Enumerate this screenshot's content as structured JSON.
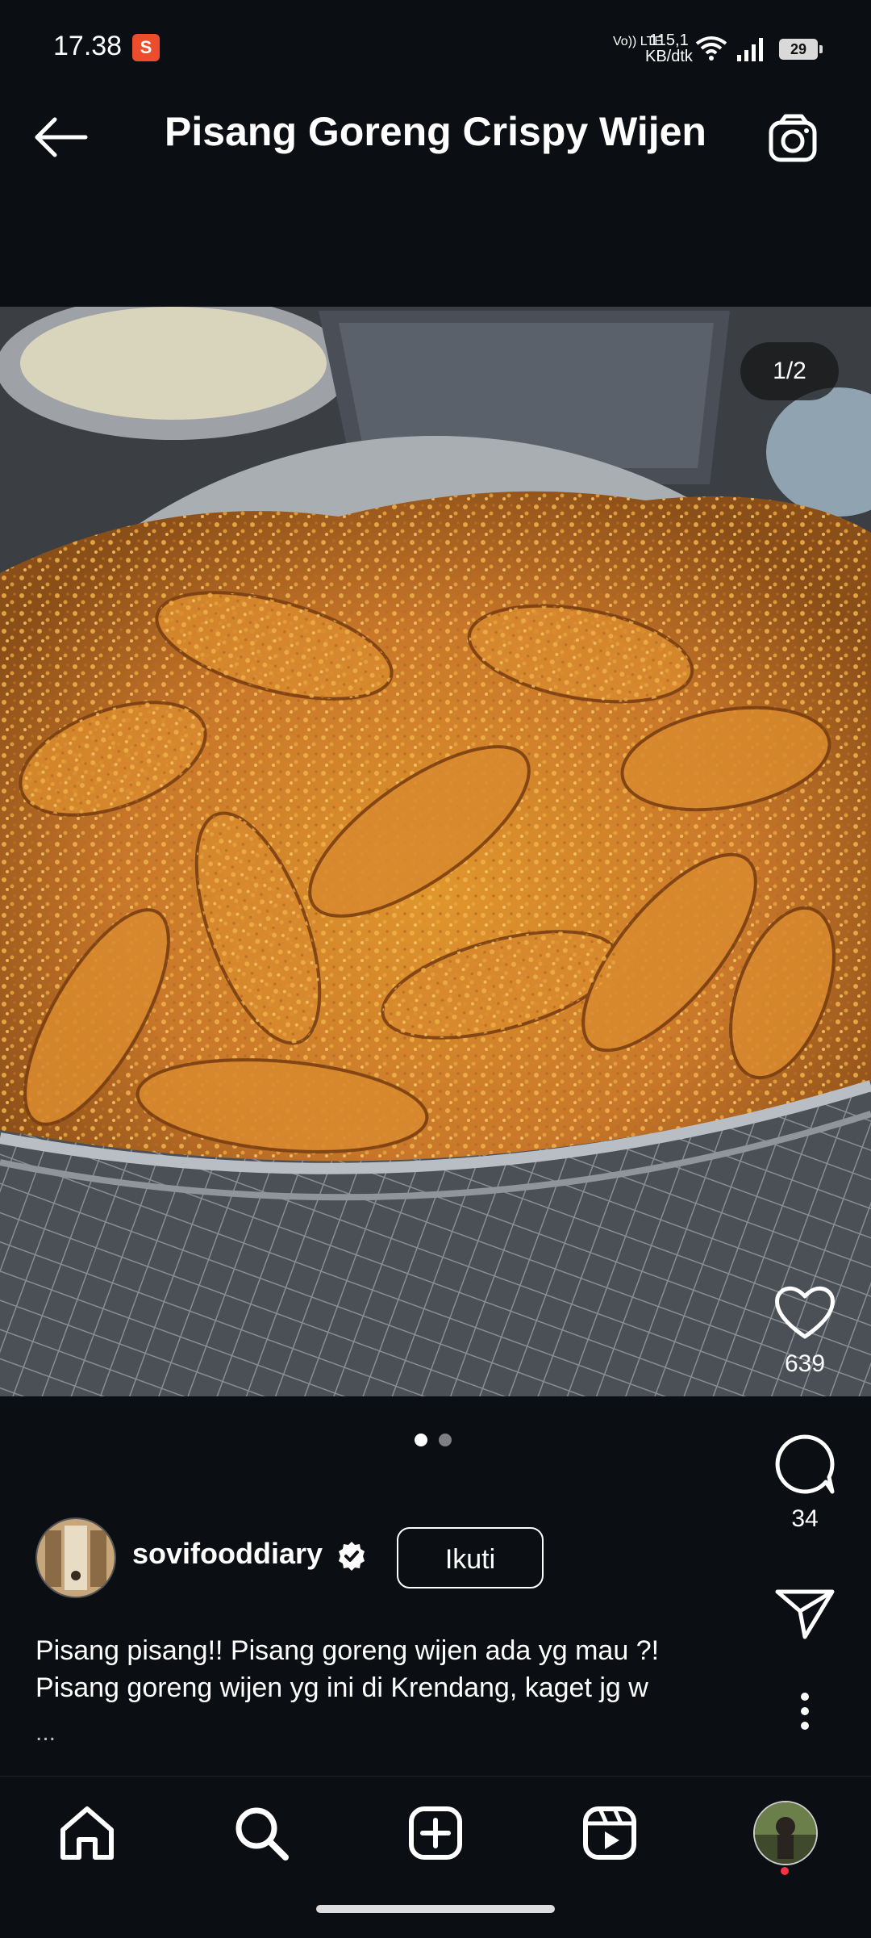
{
  "status_bar": {
    "time": "17.38",
    "app_notification_icon": "shopee-icon",
    "volte_label": "Vo)) LTE",
    "network_speed_value": "115,1",
    "network_speed_unit": "KB/dtk",
    "battery_level": "29"
  },
  "header": {
    "title": "Pisang Goreng Crispy Wijen",
    "back_icon": "arrow-left-icon",
    "camera_icon": "camera-icon"
  },
  "post": {
    "image_counter": "1/2",
    "carousel": {
      "total": 2,
      "active": 1
    },
    "likes_count": "639",
    "comments_count": "34",
    "author": {
      "username": "sovifooddiary",
      "verified": true,
      "follow_label": "Ikuti"
    },
    "caption_lines": [
      "Pisang pisang!! Pisang goreng wijen ada yg mau ?!",
      "Pisang goreng wijen yg ini di Krendang, kaget jg w"
    ],
    "caption_more": "..."
  },
  "bottom_nav": {
    "items": [
      "home-icon",
      "search-icon",
      "create-post-icon",
      "reels-icon",
      "profile-avatar"
    ],
    "profile_has_notification": true
  },
  "colors": {
    "background": "#0b0f14",
    "text": "#ffffff",
    "notification_dot": "#ff3040",
    "shopee": "#ee4d2d"
  }
}
